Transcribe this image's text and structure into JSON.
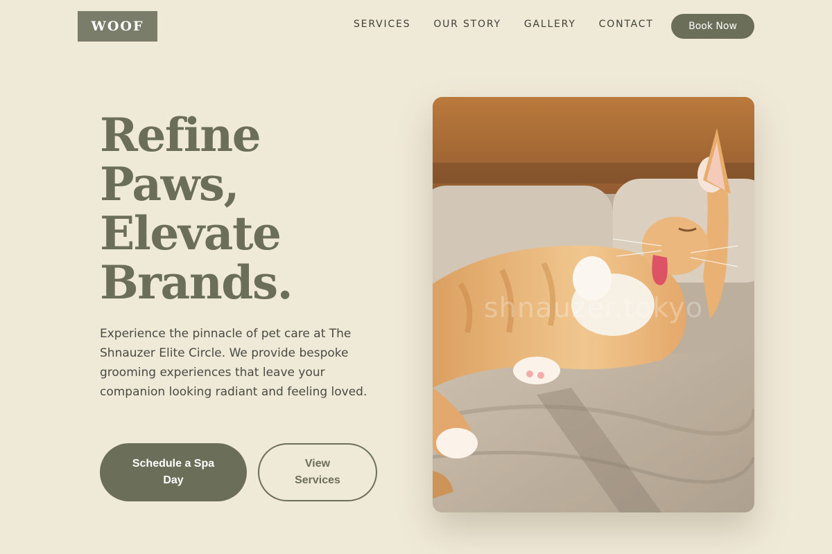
{
  "header": {
    "logo": "WOOF",
    "nav": [
      "SERVICES",
      "OUR STORY",
      "GALLERY",
      "CONTACT"
    ],
    "book_button": "Book Now"
  },
  "hero": {
    "title_lines": [
      "Refine",
      "Paws,",
      "Elevate",
      "Brands."
    ],
    "description": "Experience the pinnacle of pet care at The Shnauzer Elite Circle. We provide bespoke grooming experiences that leave your companion looking radiant and feeling loved.",
    "primary_button": "Schedule a Spa Day",
    "secondary_button": "View Services",
    "image_watermark": "shnauzer.tokyo"
  },
  "colors": {
    "background": "#efead7",
    "accent": "#6b6f5a",
    "logo_bg": "#7a7d69"
  }
}
